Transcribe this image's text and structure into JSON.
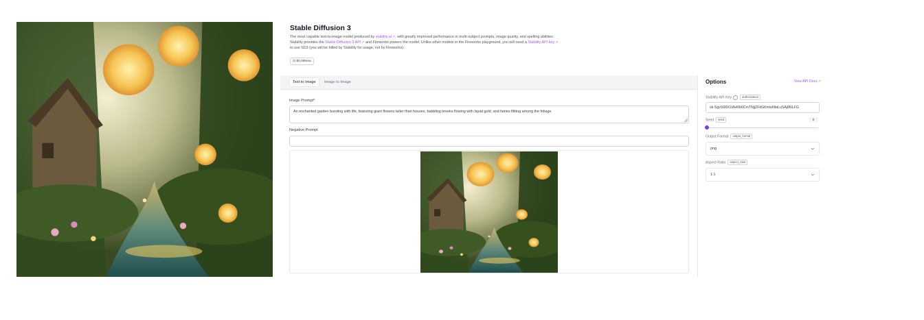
{
  "page": {
    "title": "Stable Diffusion 3",
    "description": {
      "p1": "The most capable text-to-image model produced by ",
      "link1": "stability.ai",
      "p2": ", with greatly improved performance in multi-subject prompts, image quality, and spelling abilities.",
      "p3": "Stability provides the ",
      "link2": "Stable Diffusion 3 API",
      "p4": " and Fireworks powers the model. Unlike other models in the Fireworks playground, you will need a ",
      "link3": "Stability API key",
      "p5": "to use SD3 (you will be billed by Stability for usage, not by Fireworks)."
    },
    "price": "$0.065/ea"
  },
  "playground": {
    "tabs": [
      "Text to Image",
      "Image to Image"
    ],
    "image_prompt_label": "Image Prompt*",
    "image_prompt_value": "An enchanted garden bursting with life, featuring giant flowers taller than houses, babbling brooks flowing with liquid gold, and fairies flitting among the foliage",
    "negative_prompt_label": "Negative Prompt",
    "negative_prompt_value": ""
  },
  "options": {
    "title": "Options",
    "api_docs_label": "View API Docs",
    "api_key_label": "Stability API Key",
    "api_key_tag": "authorization",
    "api_key_value": "sk-SgvS68X1tAH0b6CmTNjjZFdGKmwIIltaLuSAj8NLFG",
    "seed_label": "Seed",
    "seed_tag": "seed",
    "seed_value": "0",
    "seed_fraction": 0,
    "output_format_label": "Output Format",
    "output_format_tag": "output_format",
    "output_format_value": "png",
    "aspect_ratio_label": "Aspect Ratio",
    "aspect_ratio_tag": "aspect_ratio",
    "aspect_ratio_value": "1:1"
  },
  "colors": {
    "accent": "#a855f7",
    "slider": "#7c3aed"
  },
  "icons": [
    "external-link-icon",
    "info-icon",
    "chevron-down-icon",
    "resize-handle-icon"
  ]
}
